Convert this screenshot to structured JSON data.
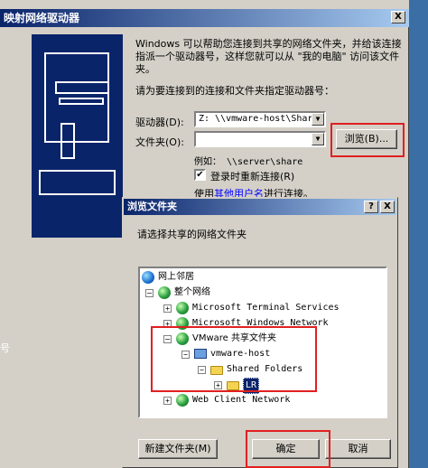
{
  "outer_dialog": {
    "title": "映射网络驱动器",
    "close_label": "X",
    "description": "Windows 可以帮助您连接到共享的网络文件夹，并给该连接指派一个驱动器号，这样您就可以从 \"我的电脑\" 访问该文件夹。",
    "prompt": "请为要连接到的连接和文件夹指定驱动器号：",
    "drive_label": "驱动器(D):",
    "drive_value": "Z:   \\\\vmware-host\\Shar",
    "folder_label": "文件夹(O):",
    "folder_value": "",
    "browse_button": "浏览(B)...",
    "example": "例如：  \\\\server\\share",
    "reconnect_label": "登录时重新连接(R)",
    "reconnect_checked": "✔",
    "other_user_prefix": "使用",
    "other_user_link": "其他用户名",
    "other_user_suffix": "进行连接。"
  },
  "left_edge_text": "号",
  "inner_dialog": {
    "title": "浏览文件夹",
    "help_label": "?",
    "close_label": "X",
    "prompt": "请选择共享的网络文件夹",
    "tree": [
      {
        "label": "网上邻居",
        "expander": "",
        "icon": "network-places-icon"
      },
      {
        "label": "整个网络",
        "expander": "−",
        "icon": "entire-network-icon"
      },
      {
        "label": "Microsoft Terminal Services",
        "expander": "+",
        "icon": "network-globe-icon"
      },
      {
        "label": "Microsoft Windows Network",
        "expander": "+",
        "icon": "network-globe-icon"
      },
      {
        "label": "VMware 共享文件夹",
        "expander": "−",
        "icon": "network-globe-icon"
      },
      {
        "label": "vmware-host",
        "expander": "−",
        "icon": "computer-icon"
      },
      {
        "label": "Shared Folders",
        "expander": "−",
        "icon": "shared-folder-icon"
      },
      {
        "label": "LR",
        "expander": "+",
        "icon": "folder-icon"
      },
      {
        "label": "Web Client Network",
        "expander": "+",
        "icon": "network-globe-icon"
      }
    ],
    "new_folder_button": "新建文件夹(M)",
    "ok_button": "确定",
    "cancel_button": "取消"
  },
  "colors": {
    "highlight_box": "#e02020",
    "title_bar": "#0a246a",
    "dialog_face": "#d4d0c8"
  }
}
